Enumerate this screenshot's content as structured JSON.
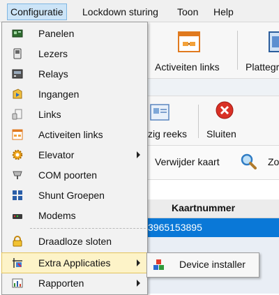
{
  "menubar": {
    "items": [
      {
        "label": "Configuratie"
      },
      {
        "label": "Lockdown sturing"
      },
      {
        "label": "Toon"
      },
      {
        "label": "Help"
      }
    ]
  },
  "toolbar1": {
    "activity_links_label": "Activeiten links",
    "floorplan_label": "Plattegr"
  },
  "toolbar2": {
    "reeks_label": "zig reeks",
    "close_label": "Sluiten"
  },
  "actionbar": {
    "remove_card_label": "Verwijder kaart",
    "search_label": "Zo"
  },
  "grid": {
    "header": "Kaartnummer",
    "rows": [
      {
        "card_number": "3965153895"
      }
    ]
  },
  "menu": {
    "items": [
      {
        "label": "Panelen",
        "icon": "panel-icon"
      },
      {
        "label": "Lezers",
        "icon": "reader-icon"
      },
      {
        "label": "Relays",
        "icon": "relay-icon"
      },
      {
        "label": "Ingangen",
        "icon": "input-icon"
      },
      {
        "label": "Links",
        "icon": "links-icon"
      },
      {
        "label": "Activeiten links",
        "icon": "activity-links-icon"
      },
      {
        "label": "Elevator",
        "icon": "elevator-gear-icon",
        "submenu": true
      },
      {
        "label": "COM poorten",
        "icon": "com-port-icon"
      },
      {
        "label": "Shunt Groepen",
        "icon": "shunt-groups-icon"
      },
      {
        "label": "Modems",
        "icon": "modem-icon"
      },
      {
        "label": "Draadloze sloten",
        "icon": "lock-icon"
      },
      {
        "label": "Extra Applicaties",
        "icon": "extra-apps-icon",
        "submenu": true,
        "highlighted": true
      },
      {
        "label": "Rapporten",
        "icon": "reports-icon",
        "submenu": true
      }
    ]
  },
  "submenu": {
    "items": [
      {
        "label": "Device installer",
        "icon": "device-installer-icon"
      }
    ]
  },
  "colors": {
    "menubar_active": "#cce4f7",
    "menu_highlight": "#fdf3c8",
    "grid_selection": "#0a78d7",
    "close_red": "#d93025"
  }
}
